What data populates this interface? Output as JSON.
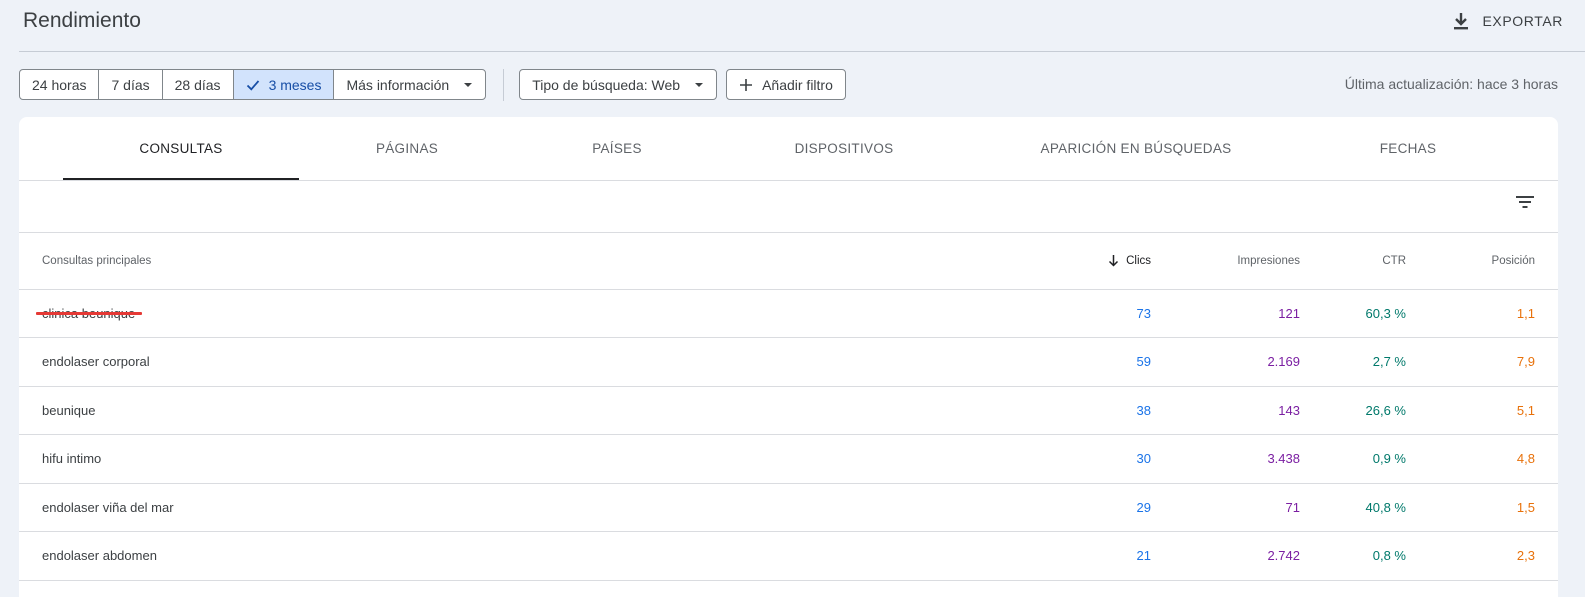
{
  "header": {
    "title": "Rendimiento",
    "export_label": "EXPORTAR"
  },
  "filters": {
    "date_ranges": [
      "24 horas",
      "7 días",
      "28 días",
      "3 meses"
    ],
    "active_range": "3 meses",
    "more_info_label": "Más información",
    "search_type_label": "Tipo de búsqueda: Web",
    "add_filter_label": "Añadir filtro",
    "last_update": "Última actualización: hace 3 horas"
  },
  "tabs": [
    "CONSULTAS",
    "PÁGINAS",
    "PAÍSES",
    "DISPOSITIVOS",
    "APARICIÓN EN BÚSQUEDAS",
    "FECHAS"
  ],
  "active_tab": "CONSULTAS",
  "table": {
    "columns": {
      "query": "Consultas principales",
      "clicks": "Clics",
      "impressions": "Impresiones",
      "ctr": "CTR",
      "position": "Posición"
    },
    "sorted_by": "clicks",
    "rows": [
      {
        "query": "clinica beunique",
        "clicks": "73",
        "impressions": "121",
        "ctr": "60,3 %",
        "position": "1,1",
        "redacted": true
      },
      {
        "query": "endolaser corporal",
        "clicks": "59",
        "impressions": "2.169",
        "ctr": "2,7 %",
        "position": "7,9"
      },
      {
        "query": "beunique",
        "clicks": "38",
        "impressions": "143",
        "ctr": "26,6 %",
        "position": "5,1"
      },
      {
        "query": "hifu intimo",
        "clicks": "30",
        "impressions": "3.438",
        "ctr": "0,9 %",
        "position": "4,8"
      },
      {
        "query": "endolaser viña del mar",
        "clicks": "29",
        "impressions": "71",
        "ctr": "40,8 %",
        "position": "1,5"
      },
      {
        "query": "endolaser abdomen",
        "clicks": "21",
        "impressions": "2.742",
        "ctr": "0,8 %",
        "position": "2,3"
      }
    ]
  },
  "colors": {
    "clicks": "#1a73e8",
    "impressions": "#7b1fa2",
    "ctr": "#00796b",
    "position": "#e8710a",
    "redaction": "#e53935",
    "active_range_bg": "#d2e3fc"
  },
  "icons": [
    "download-icon",
    "check-icon",
    "dropdown-caret-icon",
    "plus-icon",
    "filter-list-icon",
    "arrow-down-icon"
  ]
}
